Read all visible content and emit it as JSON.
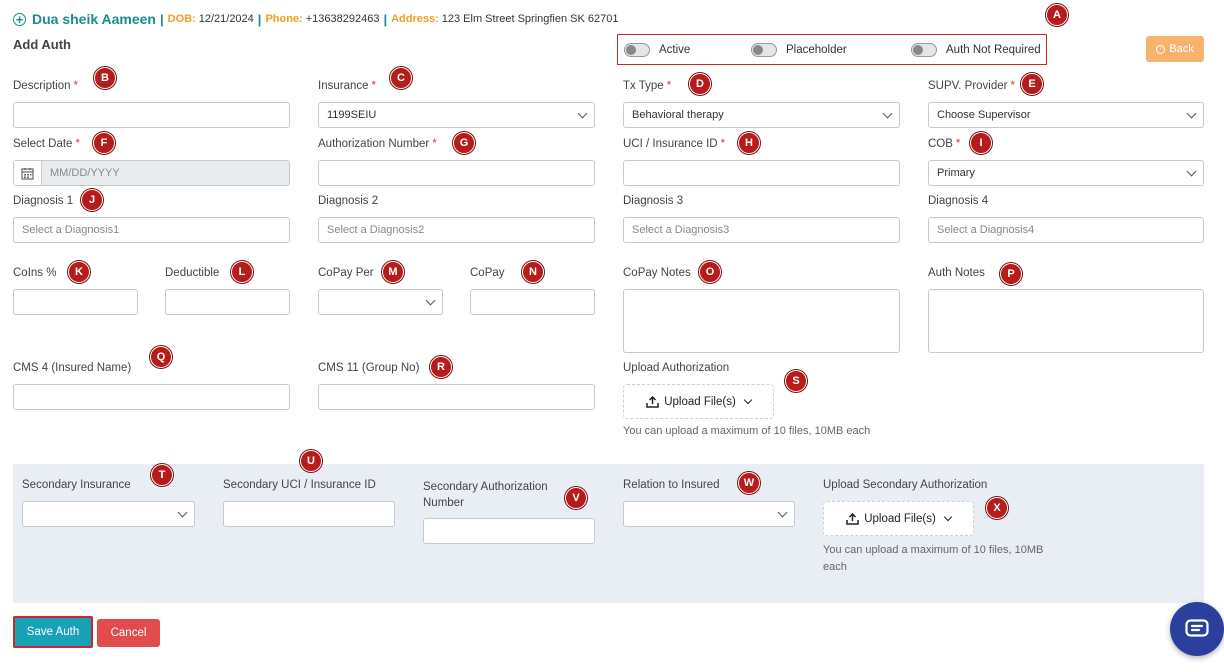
{
  "patient": {
    "name": "Dua sheik Aameen",
    "dob_label": "DOB:",
    "dob": "12/21/2024",
    "phone_label": "Phone:",
    "phone": "+13638292463",
    "address_label": "Address:",
    "address": "123 Elm Street Springfien SK 62701",
    "separator": "|"
  },
  "page": {
    "title": "Add Auth"
  },
  "toggles": {
    "active": "Active",
    "placeholder": "Placeholder",
    "auth_not_required": "Auth Not Required"
  },
  "back_button": "Back",
  "fields": {
    "description": {
      "label": "Description",
      "required": "*",
      "value": ""
    },
    "insurance": {
      "label": "Insurance",
      "required": "*",
      "value": "1199SEIU"
    },
    "tx_type": {
      "label": "Tx Type",
      "required": "*",
      "value": "Behavioral therapy"
    },
    "supv_provider": {
      "label": "SUPV. Provider",
      "required": "*",
      "value": "Choose Supervisor"
    },
    "select_date": {
      "label": "Select Date",
      "required": "*",
      "placeholder": "MM/DD/YYYY"
    },
    "authorization_number": {
      "label": "Authorization Number",
      "required": "*",
      "value": ""
    },
    "uci_insurance_id": {
      "label": "UCI / Insurance ID",
      "required": "*",
      "value": ""
    },
    "cob": {
      "label": "COB",
      "required": "*",
      "value": "Primary"
    },
    "diagnosis1": {
      "label": "Diagnosis 1",
      "placeholder": "Select a Diagnosis1"
    },
    "diagnosis2": {
      "label": "Diagnosis 2",
      "placeholder": "Select a Diagnosis2"
    },
    "diagnosis3": {
      "label": "Diagnosis 3",
      "placeholder": "Select a Diagnosis3"
    },
    "diagnosis4": {
      "label": "Diagnosis 4",
      "placeholder": "Select a Diagnosis4"
    },
    "coins": {
      "label": "CoIns %"
    },
    "deductible": {
      "label": "Deductible"
    },
    "copay_per": {
      "label": "CoPay Per"
    },
    "copay": {
      "label": "CoPay"
    },
    "copay_notes": {
      "label": "CoPay Notes"
    },
    "auth_notes": {
      "label": "Auth Notes"
    },
    "cms4": {
      "label": "CMS 4 (Insured Name)"
    },
    "cms11": {
      "label": "CMS 11 (Group No)"
    },
    "upload_authorization": {
      "label": "Upload Authorization",
      "button": "Upload File(s)",
      "hint": "You can upload a maximum of 10 files, 10MB each"
    }
  },
  "secondary": {
    "insurance": {
      "label": "Secondary Insurance"
    },
    "uci": {
      "label": "Secondary UCI / Insurance ID"
    },
    "auth_number": {
      "label_line1": "Secondary Authorization",
      "label_line2": "Number"
    },
    "relation": {
      "label": "Relation to Insured"
    },
    "upload": {
      "label": "Upload Secondary Authorization",
      "button": "Upload File(s)",
      "hint_line1": "You can upload a maximum of 10 files, 10MB",
      "hint_line2": "each"
    }
  },
  "actions": {
    "save": "Save Auth",
    "cancel": "Cancel"
  },
  "badges": {
    "a": "A",
    "b": "B",
    "c": "C",
    "d": "D",
    "e": "E",
    "f": "F",
    "g": "G",
    "h": "H",
    "i": "I",
    "j": "J",
    "k": "K",
    "l": "L",
    "m": "M",
    "n": "N",
    "o": "O",
    "p": "P",
    "q": "Q",
    "r": "R",
    "s": "S",
    "t": "T",
    "u": "U",
    "v": "V",
    "w": "W",
    "x": "X"
  },
  "icons": {
    "header": "plus-circle-icon",
    "back": "arrow-circle-icon",
    "calendar": "calendar-icon",
    "upload": "upload-icon",
    "chat": "chat-icon"
  },
  "colors": {
    "brand_teal": "#1a8c8c",
    "accent_orange": "#f0a020",
    "save": "#17a2b8",
    "cancel": "#e14b4b",
    "badge": "#b71c1c",
    "panel": "#e9edf4",
    "chat": "#2b3f9e"
  }
}
